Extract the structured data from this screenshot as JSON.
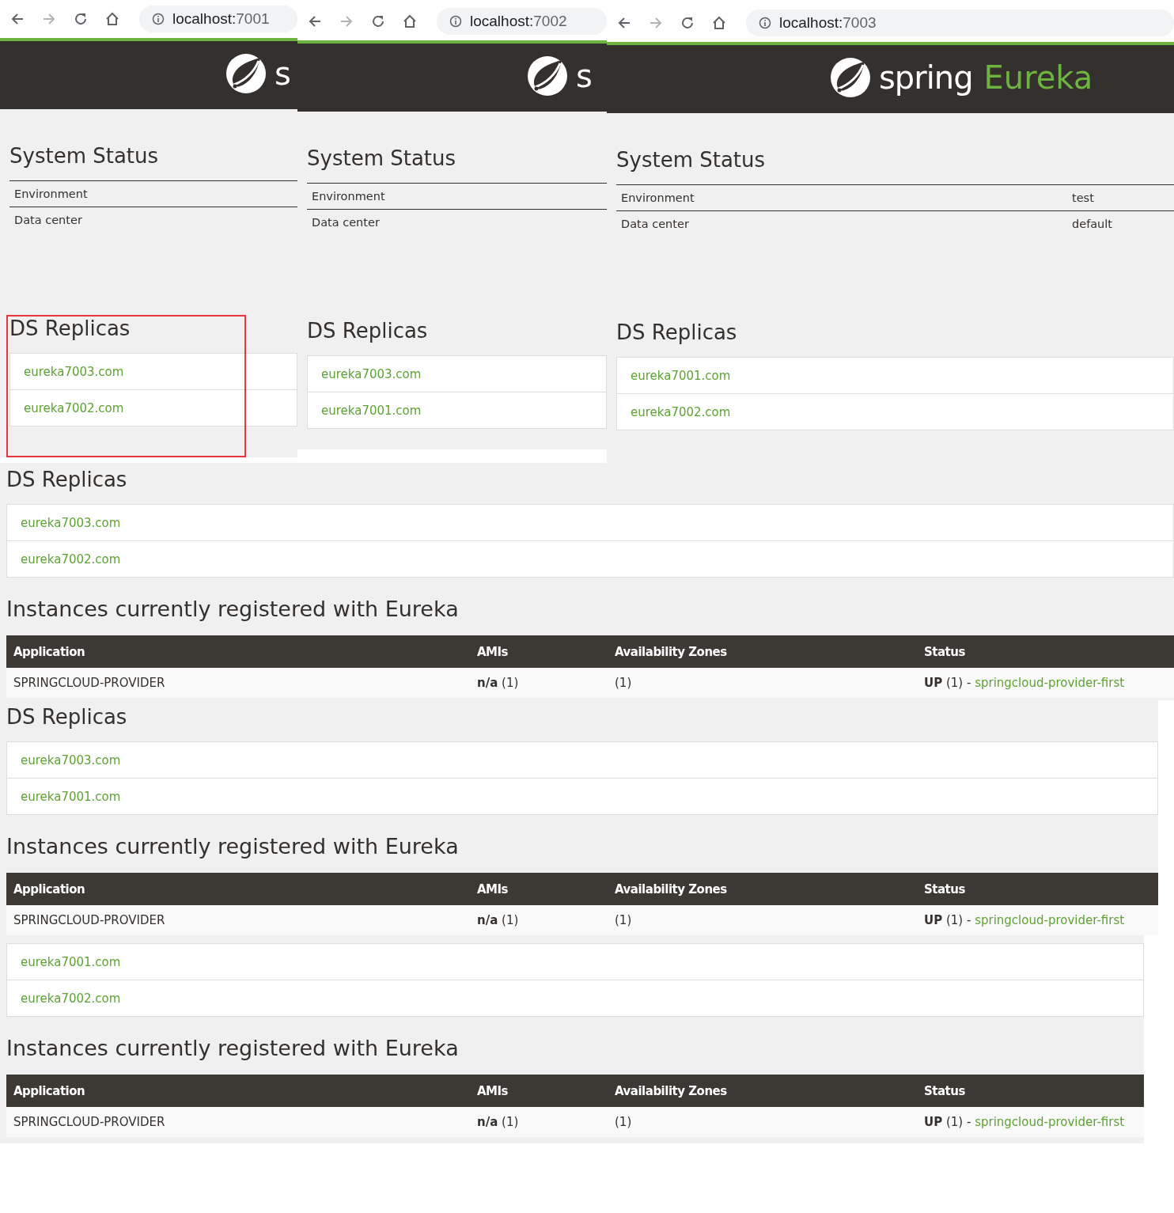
{
  "windows": [
    {
      "url_host": "localhost:",
      "url_port": "7001",
      "logo_text": "s",
      "highlighted": true,
      "status_title": "System Status",
      "status_rows": [
        {
          "label": "Environment"
        },
        {
          "label": "Data center"
        }
      ],
      "replicas_title": "DS Replicas",
      "replicas": [
        "eureka7003.com",
        "eureka7002.com"
      ]
    },
    {
      "url_host": "localhost:",
      "url_port": "7002",
      "logo_text": "s",
      "highlighted": false,
      "status_title": "System Status",
      "status_rows": [
        {
          "label": "Environment"
        },
        {
          "label": "Data center"
        }
      ],
      "replicas_title": "DS Replicas",
      "replicas": [
        "eureka7003.com",
        "eureka7001.com"
      ]
    },
    {
      "url_host": "localhost:",
      "url_port": "7003",
      "logo_text": "spring",
      "brand": "Eureka",
      "highlighted": false,
      "status_title": "System Status",
      "status_rows": [
        {
          "label": "Environment",
          "value": "test"
        },
        {
          "label": "Data center",
          "value": "default"
        }
      ],
      "replicas_title": "DS Replicas",
      "replicas": [
        "eureka7001.com",
        "eureka7002.com"
      ]
    }
  ],
  "fragments": [
    {
      "replicas_title": "DS Replicas",
      "replicas": [
        "eureka7003.com",
        "eureka7002.com"
      ],
      "instances_title": "Instances currently registered with Eureka",
      "columns": [
        "Application",
        "AMIs",
        "Availability Zones",
        "Status"
      ],
      "rows": [
        {
          "application": "SPRINGCLOUD-PROVIDER",
          "amis": "**n/a** (1)",
          "zones": "(1)",
          "status": "**UP** (1) -",
          "instance": "springcloud-provider-first"
        }
      ]
    },
    {
      "replicas_title": "DS Replicas",
      "replicas": [
        "eureka7003.com",
        "eureka7001.com"
      ],
      "instances_title": "Instances currently registered with Eureka",
      "columns": [
        "Application",
        "AMIs",
        "Availability Zones",
        "Status"
      ],
      "rows": [
        {
          "application": "SPRINGCLOUD-PROVIDER",
          "amis": "**n/a** (1)",
          "zones": "(1)",
          "status": "**UP** (1) -",
          "instance": "springcloud-provider-first"
        }
      ]
    },
    {
      "replicas": [
        "eureka7001.com",
        "eureka7002.com"
      ],
      "instances_title": "Instances currently registered with Eureka",
      "columns": [
        "Application",
        "AMIs",
        "Availability Zones",
        "Status"
      ],
      "rows": [
        {
          "application": "SPRINGCLOUD-PROVIDER",
          "amis": "**n/a** (1)",
          "zones": "(1)",
          "status": "**UP** (1) -",
          "instance": "springcloud-provider-first"
        }
      ]
    }
  ]
}
